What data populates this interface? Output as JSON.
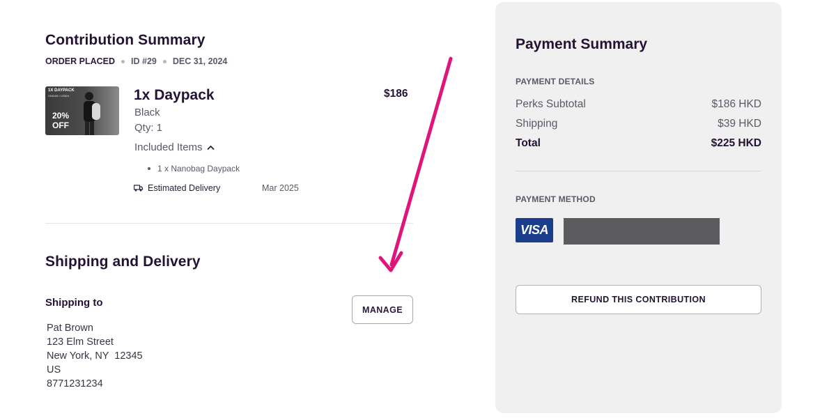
{
  "contribution": {
    "title": "Contribution Summary",
    "status": "ORDER PLACED",
    "order_id": "ID #29",
    "date": "DEC 31, 2024"
  },
  "product": {
    "image_badge_top": "1X DAYPACK",
    "image_badge_price": "HK$186 • US$24",
    "image_discount": "20% OFF",
    "name": "1x Daypack",
    "price": "$186",
    "color": "Black",
    "qty": "Qty: 1",
    "included_label": "Included Items",
    "included_items": [
      "1 x Nanobag Daypack"
    ],
    "estimated_delivery_label": "Estimated Delivery",
    "estimated_delivery_date": "Mar 2025"
  },
  "shipping": {
    "title": "Shipping and Delivery",
    "shipping_to_label": "Shipping to",
    "manage_label": "MANAGE",
    "address": {
      "name": "Pat Brown",
      "street": "123 Elm Street",
      "city_line": "New York, NY  12345",
      "country": "US",
      "phone": "8771231234"
    }
  },
  "payment": {
    "title": "Payment Summary",
    "details_label": "PAYMENT DETAILS",
    "rows": [
      {
        "label": "Perks Subtotal",
        "value": "$186 HKD"
      },
      {
        "label": "Shipping",
        "value": "$39 HKD"
      },
      {
        "label": "Total",
        "value": "$225 HKD"
      }
    ],
    "method_label": "PAYMENT METHOD",
    "card_brand": "VISA",
    "refund_label": "REFUND THIS CONTRIBUTION"
  },
  "colors": {
    "accent_arrow": "#e0157a",
    "text_dark": "#241235",
    "panel_bg": "#f0f0f0",
    "visa_blue": "#1a3e8c"
  }
}
